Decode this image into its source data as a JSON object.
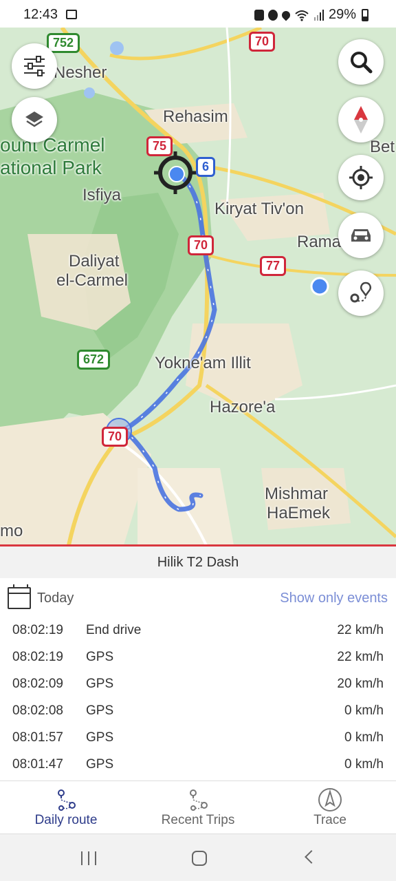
{
  "status_bar": {
    "time": "12:43",
    "battery": "29%"
  },
  "map": {
    "labels": {
      "nesher": "Nesher",
      "rehasim": "Rehasim",
      "park_line1": "ount Carmel",
      "park_line2": "ational Park",
      "isfiya": "Isfiya",
      "kiryat_tivon": "Kiryat Tiv'on",
      "rama": "Rama",
      "daliyat1": "Daliyat",
      "daliyat2": "el-Carmel",
      "yokneam": "Yokne'am Illit",
      "hazorea": "Hazore'a",
      "mishmar1": "Mishmar",
      "mishmar2": "HaEmek",
      "bet": "Bet",
      "mo": "mo"
    },
    "shields": [
      "752",
      "70",
      "75",
      "6",
      "70",
      "77",
      "672",
      "70"
    ],
    "icons": {
      "filter": "sliders-icon",
      "layers": "layers-icon",
      "search": "search-icon",
      "compass": "compass-icon",
      "locate": "crosshair-icon",
      "vehicle": "car-icon",
      "route": "route-pin-icon"
    },
    "colors": {
      "route": "#4a74e0",
      "accent_red": "#d9373f",
      "park": "#b9dcb0"
    }
  },
  "device": {
    "name": "Hilik T2 Dash"
  },
  "date_row": {
    "label": "Today",
    "filter_link": "Show only events"
  },
  "events": [
    {
      "time": "08:02:19",
      "type": "End drive",
      "speed": "22 km/h"
    },
    {
      "time": "08:02:19",
      "type": "GPS",
      "speed": "22 km/h"
    },
    {
      "time": "08:02:09",
      "type": "GPS",
      "speed": "20 km/h"
    },
    {
      "time": "08:02:08",
      "type": "GPS",
      "speed": "0 km/h"
    },
    {
      "time": "08:01:57",
      "type": "GPS",
      "speed": "0 km/h"
    },
    {
      "time": "08:01:47",
      "type": "GPS",
      "speed": "0 km/h"
    }
  ],
  "tabs": [
    {
      "label": "Daily route",
      "icon": "route-icon",
      "active": true
    },
    {
      "label": "Recent Trips",
      "icon": "trips-icon",
      "active": false
    },
    {
      "label": "Trace",
      "icon": "trace-compass-icon",
      "active": false
    }
  ]
}
